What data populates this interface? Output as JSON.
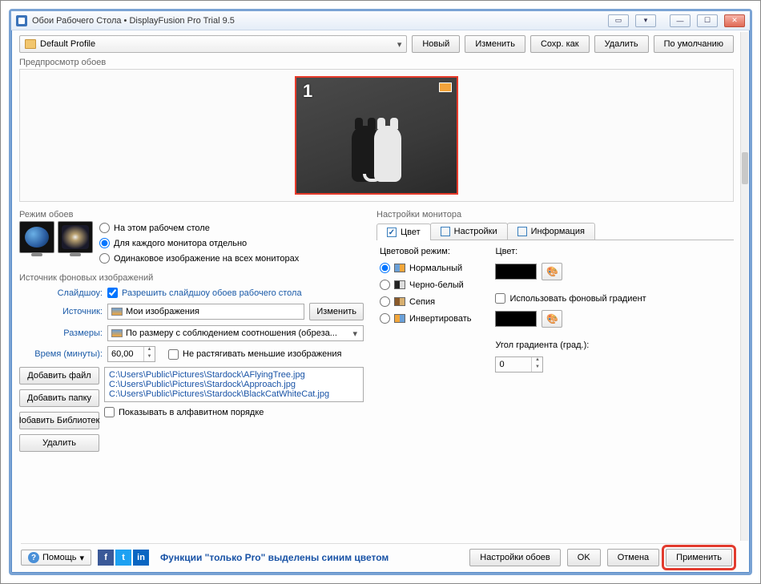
{
  "window": {
    "title": "Обои Рабочего Стола • DisplayFusion Pro Trial 9.5"
  },
  "profile": {
    "selected": "Default Profile"
  },
  "top_buttons": {
    "new": "Новый",
    "edit": "Изменить",
    "save_as": "Сохр. как",
    "delete": "Удалить",
    "default": "По умолчанию"
  },
  "preview": {
    "label": "Предпросмотр обоев",
    "monitor_number": "1"
  },
  "mode": {
    "label": "Режим обоев",
    "options": {
      "this_desktop": "На этом рабочем столе",
      "each_monitor": "Для каждого монитора отдельно",
      "same_all": "Одинаковое изображение на всех мониторах"
    }
  },
  "source": {
    "label": "Источник фоновых изображений",
    "slideshow_lbl": "Слайдшоу:",
    "slideshow_cb": "Разрешить слайдшоу обоев рабочего стола",
    "source_lbl": "Источник:",
    "source_val": "Мои изображения",
    "change_btn": "Изменить",
    "sizes_lbl": "Размеры:",
    "sizes_val": "По размеру с соблюдением соотношения (обреза...",
    "time_lbl": "Время (минуты):",
    "time_val": "60,00",
    "no_stretch": "Не растягивать меньшие изображения",
    "add_file": "Добавить файл",
    "add_folder": "Добавить папку",
    "add_library": "Іобавить Библиотек",
    "delete": "Удалить",
    "files": [
      "C:\\Users\\Public\\Pictures\\Stardock\\AFlyingTree.jpg",
      "C:\\Users\\Public\\Pictures\\Stardock\\Approach.jpg",
      "C:\\Users\\Public\\Pictures\\Stardock\\BlackCatWhiteCat.jpg"
    ],
    "alpha_cb": "Показывать в алфавитном порядке"
  },
  "monitor": {
    "label": "Настройки монитора",
    "tabs": {
      "color": "Цвет",
      "settings": "Настройки",
      "info": "Информация"
    },
    "color_mode_lbl": "Цветовой режим:",
    "modes": {
      "normal": "Нормальный",
      "bw": "Черно-белый",
      "sepia": "Сепия",
      "invert": "Инвертировать"
    },
    "color_lbl": "Цвет:",
    "gradient_cb": "Использовать фоновый градиент",
    "angle_lbl": "Угол градиента (град.):",
    "angle_val": "0"
  },
  "footer": {
    "help": "Помощь",
    "pro_note": "Функции \"только Pro\" выделены синим цветом",
    "wallpaper_settings": "Настройки обоев",
    "ok": "OK",
    "cancel": "Отмена",
    "apply": "Применить"
  }
}
